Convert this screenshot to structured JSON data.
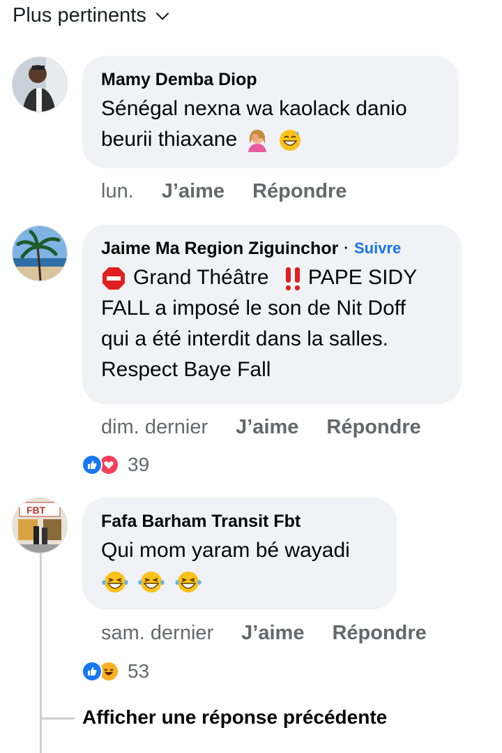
{
  "sort": {
    "label": "Plus pertinents"
  },
  "comments": [
    {
      "author": "Mamy Demba Diop",
      "line1": "Sénégal nexna wa kaolack danio",
      "line2": "beurii thiaxane",
      "emojis": [
        "facepalm-emoji",
        "grinning-sweat-emoji"
      ],
      "time": "lun.",
      "like": "J’aime",
      "reply": "Répondre"
    },
    {
      "author": "Jaime Ma Region Ziguinchor",
      "separator": "·",
      "follow": "Suivre",
      "line1": "Grand Théâtre",
      "line1b": "PAPE SIDY",
      "line2": "FALL a imposé le son de Nit Doff",
      "line3": "qui a été interdit dans la salles.",
      "line4": "Respect Baye Fall",
      "emojis": [
        "stop-sign-emoji",
        "double-exclamation-emoji"
      ],
      "time": "dim. dernier",
      "like": "J’aime",
      "reply": "Répondre",
      "reactions": [
        "like-icon",
        "love-icon"
      ],
      "reaction_count": "39"
    },
    {
      "author": "Fafa Barham Transit Fbt",
      "line1": "Qui mom yaram bé wayadi",
      "emojis": [
        "laughing-tears-emoji",
        "laughing-tears-emoji",
        "laughing-tears-emoji"
      ],
      "time": "sam. dernier",
      "like": "J’aime",
      "reply": "Répondre",
      "reactions": [
        "like-icon",
        "haha-icon"
      ],
      "reaction_count": "53"
    }
  ],
  "more_replies": "Afficher une réponse précédente",
  "colors": {
    "bubble": "#f0f2f5",
    "meta": "#65676b",
    "link": "#1b74e4",
    "like": "#1877f2",
    "love": "#f33e58",
    "haha": "#f7b125"
  }
}
